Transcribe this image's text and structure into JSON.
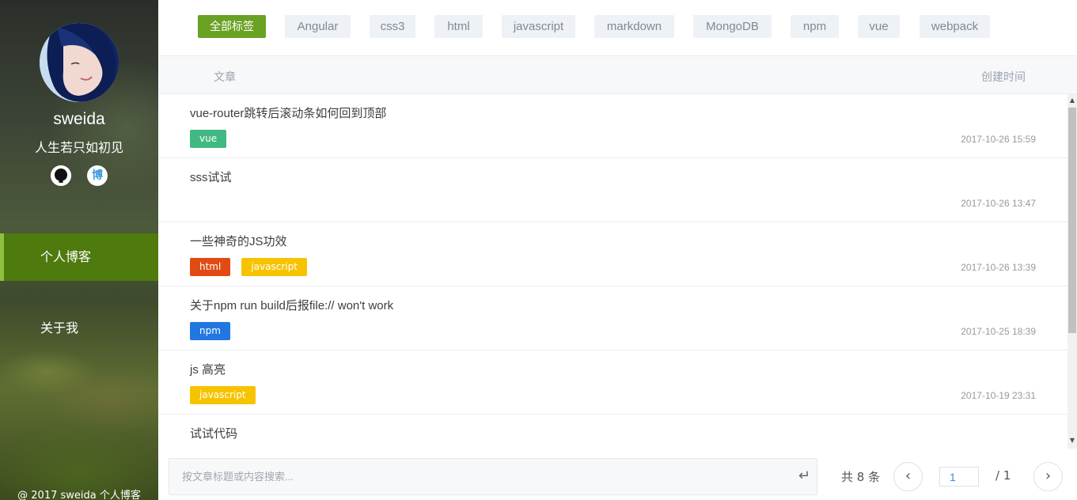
{
  "profile": {
    "username": "sweida",
    "motto": "人生若只如初见",
    "blog_icon_char": "博"
  },
  "nav": {
    "items": [
      {
        "label": "个人博客",
        "active": true
      },
      {
        "label": "关于我",
        "active": false
      }
    ]
  },
  "footer": "@ 2017 sweida 个人博客",
  "tags": {
    "all_label": "全部标签",
    "items": [
      "Angular",
      "css3",
      "html",
      "javascript",
      "markdown",
      "MongoDB",
      "npm",
      "vue",
      "webpack"
    ]
  },
  "table": {
    "col_article": "文章",
    "col_time": "创建时间"
  },
  "articles": [
    {
      "title": "vue-router跳转后滚动条如何回到顶部",
      "tags": [
        "vue"
      ],
      "date": "2017-10-26 15:59"
    },
    {
      "title": "sss试试",
      "tags": [],
      "date": "2017-10-26 13:47"
    },
    {
      "title": "一些神奇的JS功效",
      "tags": [
        "html",
        "javascript"
      ],
      "date": "2017-10-26 13:39"
    },
    {
      "title": "关于npm run build后报file:// won't work",
      "tags": [
        "npm"
      ],
      "date": "2017-10-25 18:39"
    },
    {
      "title": "js 高亮",
      "tags": [
        "javascript"
      ],
      "date": "2017-10-19 23:31"
    },
    {
      "title": "试试代码",
      "tags": [],
      "date": ""
    }
  ],
  "tag_colors": {
    "vue": "#42b983",
    "html": "#e14b13",
    "javascript": "#f7c300",
    "npm": "#2177e0"
  },
  "search": {
    "placeholder": "按文章标题或内容搜索..."
  },
  "pagination": {
    "total_text": "共 8 条",
    "current_page": "1",
    "total_pages_text": "/  1"
  },
  "icons": {
    "enter": "↵",
    "prev": "‹",
    "next": "›"
  }
}
